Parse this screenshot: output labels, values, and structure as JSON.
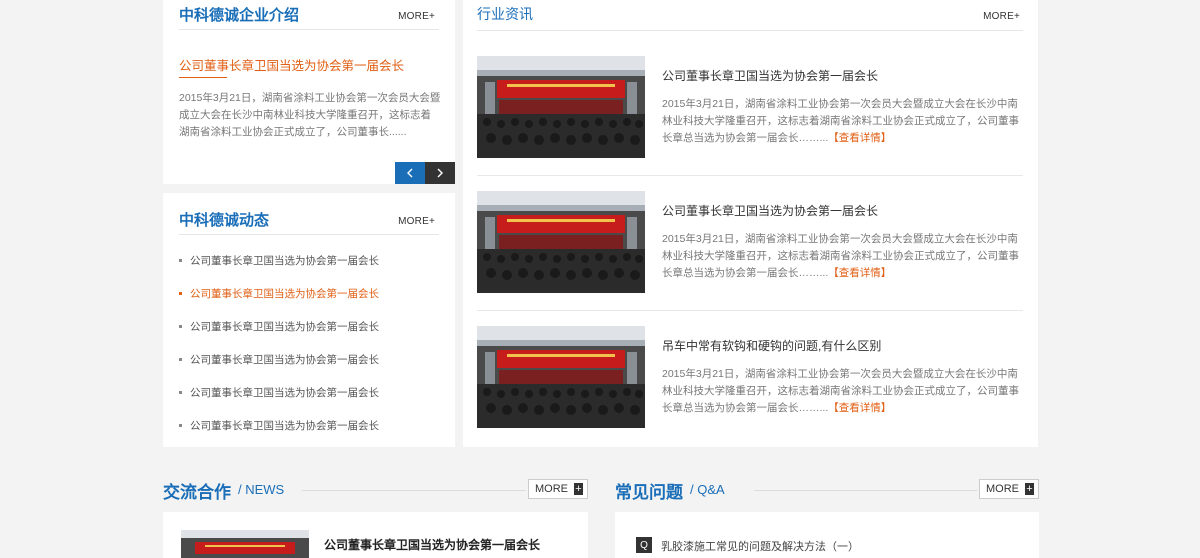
{
  "intro": {
    "title": "中科德诚企业介绍",
    "more": "MORE+",
    "headline": "公司董事长章卫国当选为协会第一届会长",
    "body": "2015年3月21日，湖南省涂料工业协会第一次会员大会暨成立大会在长沙中南林业科技大学隆重召开，这标志着湖南省涂料工业协会正式成立了，公司董事长......"
  },
  "news": {
    "title": "中科德诚动态",
    "more": "MORE+",
    "items": [
      "公司董事长章卫国当选为协会第一届会长",
      "公司董事长章卫国当选为协会第一届会长",
      "公司董事长章卫国当选为协会第一届会长",
      "公司董事长章卫国当选为协会第一届会长",
      "公司董事长章卫国当选为协会第一届会长",
      "公司董事长章卫国当选为协会第一届会长"
    ],
    "active_index": 1
  },
  "industry": {
    "title": "行业资讯",
    "more": "MORE+",
    "items": [
      {
        "title": "公司董事长章卫国当选为协会第一届会长",
        "body": "2015年3月21日，湖南省涂料工业协会第一次会员大会暨成立大会在长沙中南林业科技大学隆重召开，这标志着湖南省涂料工业协会正式成立了，公司董事长章总当选为协会第一届会长……...",
        "detail": "【查看详情】"
      },
      {
        "title": "公司董事长章卫国当选为协会第一届会长",
        "body": "2015年3月21日，湖南省涂料工业协会第一次会员大会暨成立大会在长沙中南林业科技大学隆重召开，这标志着湖南省涂料工业协会正式成立了，公司董事长章总当选为协会第一届会长……...",
        "detail": "【查看详情】"
      },
      {
        "title": "吊车中常有软钩和硬钩的问题,有什么区别",
        "body": "2015年3月21日，湖南省涂料工业协会第一次会员大会暨成立大会在长沙中南林业科技大学隆重召开，这标志着湖南省涂料工业协会正式成立了，公司董事长章总当选为协会第一届会长……...",
        "detail": "【查看详情】"
      }
    ]
  },
  "cooperation": {
    "title": "交流合作",
    "subtitle": "/ NEWS",
    "more": "MORE",
    "first_item": "公司董事长章卫国当选为协会第一届会长"
  },
  "faq": {
    "title": "常见问题",
    "subtitle": "/ Q&A",
    "more": "MORE",
    "badge": "Q",
    "first_item": "乳胶漆施工常见的问题及解决方法（一）"
  },
  "colors": {
    "brand_blue": "#1a6eb8",
    "accent_orange": "#e05f14"
  }
}
